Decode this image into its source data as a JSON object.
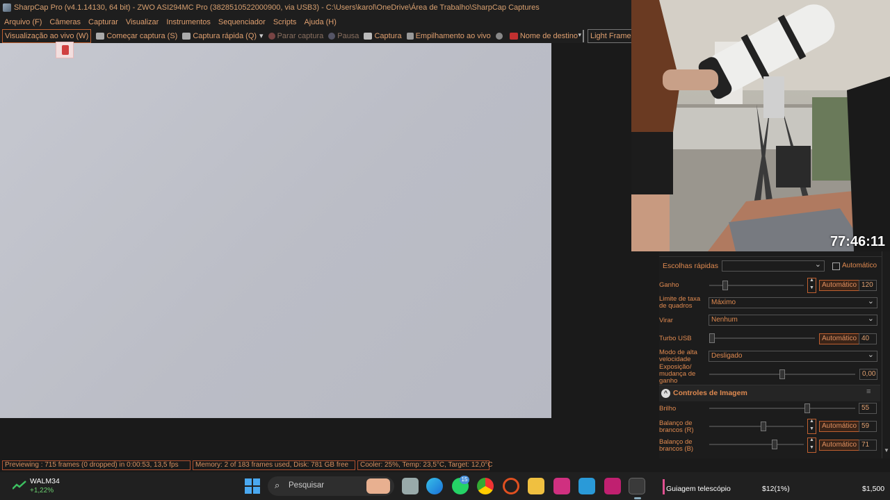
{
  "window": {
    "title": "SharpCap Pro (v4.1.14130, 64 bit) - ZWO ASI294MC Pro (3828510522000900, via USB3) - C:\\Users\\karol\\OneDrive\\Área de Trabalho\\SharpCap Captures"
  },
  "menu": [
    "Arquivo (F)",
    "Câmeras",
    "Capturar",
    "Visualizar",
    "Instrumentos",
    "Sequenciador",
    "Scripts",
    "Ajuda (H)"
  ],
  "toolbar": {
    "live_view": "Visualização ao vivo (W)",
    "start_capture": "Começar captura (S)",
    "quick_capture": "Captura rápida (Q)",
    "stop_capture": "Parar captura",
    "pause": "Pausa",
    "snapshot": "Captura",
    "live_stack": "Empilhamento ao vivo",
    "target_name": "Nome de destino",
    "frame_type": "Light Frames"
  },
  "overlay": {
    "timer": "77:46:11"
  },
  "panel": {
    "quick_picks": "Escolhas rápidas",
    "auto_checkbox": "Automático",
    "gain_label": "Ganho",
    "gain_value": "120",
    "gain_level": 0.15,
    "frame_limit_label": "Limite de taxa de quadros",
    "frame_limit_value": "Máximo",
    "flip_label": "Virar",
    "flip_value": "Nenhum",
    "turbo_label": "Turbo USB",
    "turbo_value": "40",
    "turbo_level": 0.0,
    "highspeed_label": "Modo de alta velocidade",
    "highspeed_value": "Desligado",
    "exposure_gain_label": "Exposição/ mudança de ganho",
    "exposure_gain_value": "0,00",
    "exposure_gain_level": 0.5,
    "image_controls_title": "Controles de Imagem",
    "brightness_label": "Brilho",
    "brightness_value": "55",
    "brightness_level": 0.68,
    "wb_r_label": "Balanço de brancos (R)",
    "wb_r_value": "59",
    "wb_r_level": 0.58,
    "wb_b_label": "Balanço de brancos (B)",
    "wb_b_value": "71",
    "wb_b_level": 0.7,
    "auto_label": "Automático"
  },
  "status": {
    "previewing": "Previewing : 715 frames (0 dropped) in 0:00:53, 13,5 fps",
    "memory": "Memory: 2 of 183 frames used, Disk: 781 GB free",
    "cooler": "Cooler: 25%, Temp: 23,5°C, Target: 12,0°C"
  },
  "taskbar": {
    "stock_name": "WALM34",
    "stock_change": "+1,22%",
    "search_placeholder": "Pesquisar",
    "whatsapp_badge": "15",
    "now_playing": "Guiagem telescópio",
    "donation_1": "$12(1%)",
    "donation_2": "$1,500"
  },
  "colors": {
    "accent": "#e08a50",
    "border_accent": "#c06030"
  }
}
